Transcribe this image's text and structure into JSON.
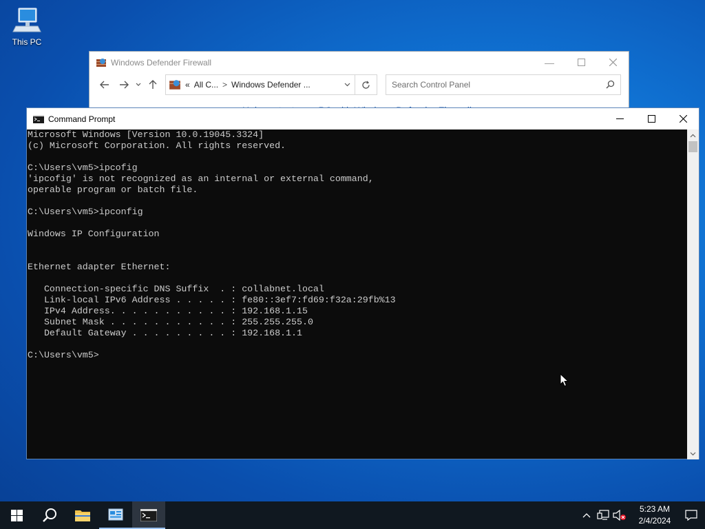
{
  "desktop": {
    "icons": [
      {
        "label": "This PC",
        "icon": "this-pc-icon"
      }
    ]
  },
  "firewall_window": {
    "title": "Windows Defender Firewall",
    "address_prefix": "«",
    "address_crumb_1": "All C...",
    "address_sep": ">",
    "address_crumb_2": "Windows Defender ...",
    "search_placeholder": "Search Control Panel",
    "peek_text": "Help protect your PC with Windows Defender Firewall"
  },
  "cmd_window": {
    "title": "Command Prompt",
    "lines": [
      "Microsoft Windows [Version 10.0.19045.3324]",
      "(c) Microsoft Corporation. All rights reserved.",
      "",
      "C:\\Users\\vm5>ipcofig",
      "'ipcofig' is not recognized as an internal or external command,",
      "operable program or batch file.",
      "",
      "C:\\Users\\vm5>ipconfig",
      "",
      "Windows IP Configuration",
      "",
      "",
      "Ethernet adapter Ethernet:",
      "",
      "   Connection-specific DNS Suffix  . : collabnet.local",
      "   Link-local IPv6 Address . . . . . : fe80::3ef7:fd69:f32a:29fb%13",
      "   IPv4 Address. . . . . . . . . . . : 192.168.1.15",
      "   Subnet Mask . . . . . . . . . . . : 255.255.255.0",
      "   Default Gateway . . . . . . . . . : 192.168.1.1",
      "",
      "C:\\Users\\vm5>"
    ]
  },
  "taskbar": {
    "apps": [
      "start-icon",
      "search-icon",
      "file-explorer-icon",
      "control-panel-icon",
      "command-prompt-icon"
    ],
    "clock_time": "5:23 AM",
    "clock_date": "2/4/2024"
  },
  "colors": {
    "console_bg": "#0c0c0c",
    "console_text": "#cccccc",
    "taskbar_bg": "#101820"
  }
}
